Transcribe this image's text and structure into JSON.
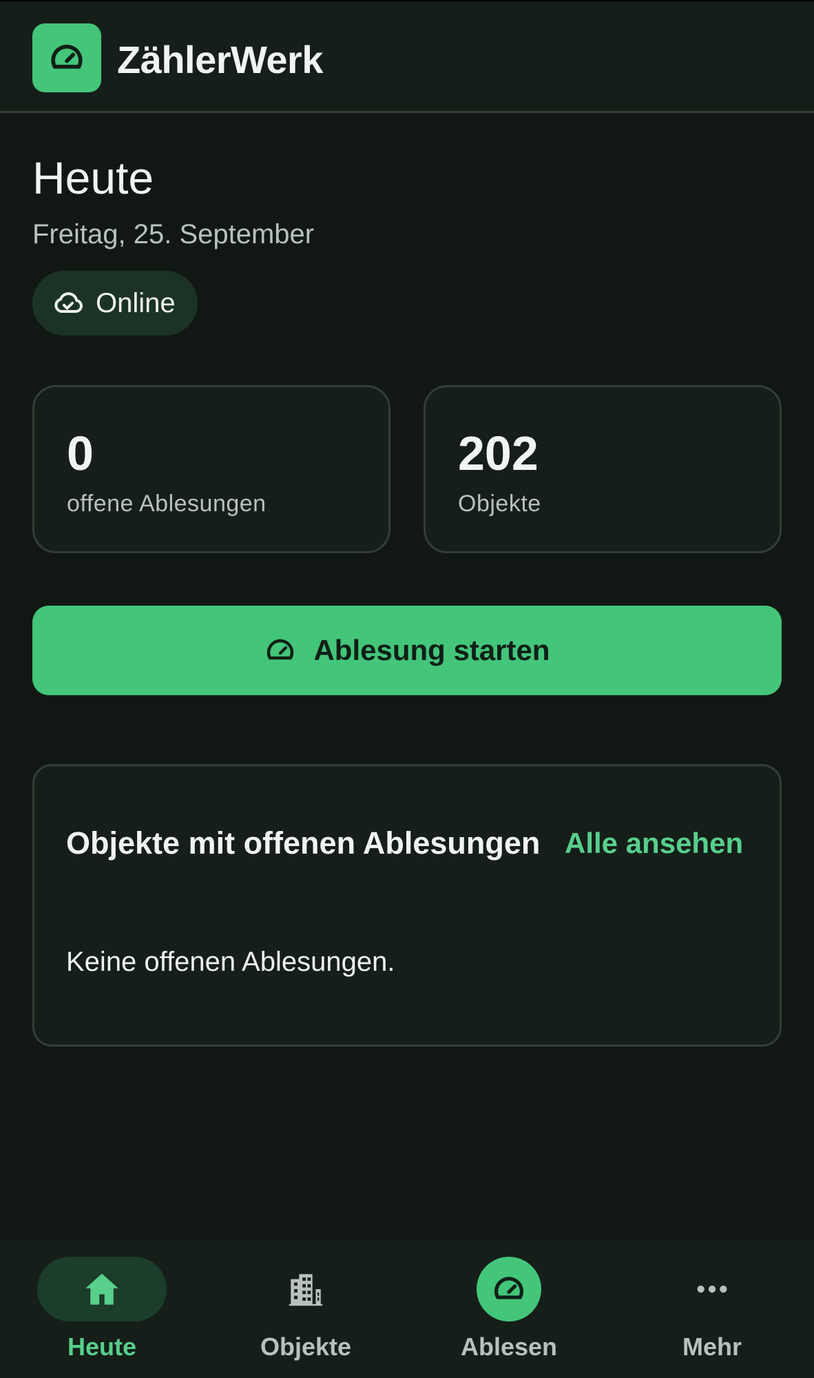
{
  "header": {
    "app_title": "ZählerWerk",
    "logo_icon": "gauge-icon"
  },
  "page": {
    "title": "Heute",
    "date": "Freitag, 25. September",
    "status_label": "Online",
    "status_icon": "cloud-check-icon"
  },
  "stats": [
    {
      "value": "0",
      "label": "offene Ablesungen"
    },
    {
      "value": "202",
      "label": "Objekte"
    }
  ],
  "primary_action": {
    "label": "Ablesung starten",
    "icon": "gauge-icon"
  },
  "open_panel": {
    "title": "Objekte mit offenen Ablesungen",
    "link_label": "Alle ansehen",
    "empty_text": "Keine offenen Ablesungen."
  },
  "nav": {
    "items": [
      {
        "label": "Heute",
        "icon": "home-icon",
        "active": true
      },
      {
        "label": "Objekte",
        "icon": "building-icon",
        "active": false
      },
      {
        "label": "Ablesen",
        "icon": "gauge-icon",
        "active": false
      },
      {
        "label": "Mehr",
        "icon": "more-icon",
        "active": false
      }
    ]
  },
  "colors": {
    "background": "#111814",
    "surface": "#151e19",
    "accent": "#43c57a",
    "accent_text": "#58cf8b",
    "border": "#333d37"
  }
}
